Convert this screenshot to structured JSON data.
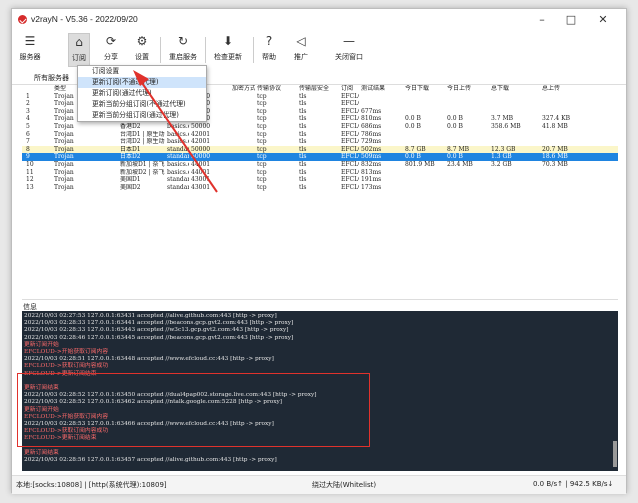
{
  "window": {
    "title": "v2rayN - V5.36 - 2022/09/20",
    "controls": [
      "–",
      "□",
      "✕"
    ]
  },
  "toolbar": [
    {
      "label": "服务器",
      "icon": "server-icon",
      "glyph": "☰"
    },
    {
      "label": "订阅",
      "icon": "subscribe-icon",
      "glyph": "⌂"
    },
    {
      "label": "分享",
      "icon": "share-icon",
      "glyph": "⟳"
    },
    {
      "label": "设置",
      "icon": "settings-icon",
      "glyph": "⚙"
    },
    {
      "label": "重启服务",
      "icon": "restart-icon",
      "glyph": "↻"
    },
    {
      "label": "检查更新",
      "icon": "update-icon",
      "glyph": "⬇"
    },
    {
      "label": "帮助",
      "icon": "help-icon",
      "glyph": "?"
    },
    {
      "label": "推广",
      "icon": "promote-icon",
      "glyph": "◁"
    },
    {
      "label": "关闭窗口",
      "icon": "close-window-icon",
      "glyph": "—"
    }
  ],
  "tabstrip": {
    "label": "所有服务器"
  },
  "menu": {
    "items": [
      {
        "label": "订阅设置",
        "highlight": false
      },
      {
        "label": "更新订阅(不通过代理)",
        "highlight": true
      },
      {
        "label": "更新订阅(通过代理)",
        "highlight": false
      },
      {
        "label": "更新当前分组订阅(不通过代理)",
        "highlight": false
      },
      {
        "label": "更新当前分组订阅(通过代理)",
        "highlight": false
      }
    ]
  },
  "grid": {
    "headers": [
      "类型",
      "别名",
      "地址",
      "端口",
      "加密方式",
      "传输协议",
      "传输层安全",
      "订阅",
      "测试结果",
      "今日下载",
      "今日上传",
      "总下载",
      "总上传"
    ],
    "rows": [
      [
        "Trojan",
        "剩余流量：",
        "basics.efcloud.cc",
        "50000",
        "",
        "tcp",
        "tls",
        "EFCLOUD",
        "",
        "",
        "",
        "",
        ""
      ],
      [
        "Trojan",
        "距离下次重",
        "basics.efcloud.cc",
        "50000",
        "",
        "tcp",
        "tls",
        "EFCLOUD",
        "",
        "",
        "",
        "",
        ""
      ],
      [
        "Trojan",
        "套餐到期：2023-11-01",
        "basics.efcloud.cc",
        "50000",
        "",
        "tcp",
        "tls",
        "EFCLOUD",
        "677ms",
        "",
        "",
        "",
        ""
      ],
      [
        "Trojan",
        "香港D1",
        "basics.efcloud.cc",
        "50000",
        "",
        "tcp",
        "tls",
        "EFCLOUD",
        "810ms",
        "0.0 B",
        "0.0 B",
        "3.7 MB",
        "327.4 KB"
      ],
      [
        "Trojan",
        "香港D2",
        "basics.efcloud.cc",
        "50000",
        "",
        "tcp",
        "tls",
        "EFCLOUD",
        "686ms",
        "0.0 B",
        "0.0 B",
        "358.6 MB",
        "41.8 MB"
      ],
      [
        "Trojan",
        "台湾D1 | 原生动画疯",
        "basics.efcloud.cc",
        "42001",
        "",
        "tcp",
        "tls",
        "EFCLOUD",
        "786ms",
        "",
        "",
        "",
        ""
      ],
      [
        "Trojan",
        "台湾D2 | 原生动画疯",
        "basics.efcloud.cc",
        "42001",
        "",
        "tcp",
        "tls",
        "EFCLOUD",
        "729ms",
        "",
        "",
        "",
        ""
      ],
      [
        "Trojan",
        "日本D1",
        "standard.efcloud.cc",
        "50000",
        "",
        "tcp",
        "tls",
        "EFCLOUD",
        "502ms",
        "8.7 GB",
        "8.7 MB",
        "12.3 GB",
        "20.7 MB"
      ],
      [
        "Trojan",
        "日本D2",
        "standard.efcloud.cc",
        "50000",
        "",
        "tcp",
        "tls",
        "EFCLOUD",
        "509ms",
        "0.0 B",
        "0.0 B",
        "1.3 GB",
        "18.6 MB"
      ],
      [
        "Trojan",
        "新加坡D1 | 奈飞",
        "basics.efcloud.cc",
        "44001",
        "",
        "tcp",
        "tls",
        "EFCLOUD",
        "832ms",
        "801.9 MB",
        "23.4 MB",
        "3.2 GB",
        "70.3 MB"
      ],
      [
        "Trojan",
        "新加坡D2 | 奈飞",
        "basics.efcloud.cc",
        "44001",
        "",
        "tcp",
        "tls",
        "EFCLOUD",
        "813ms",
        "",
        "",
        "",
        ""
      ],
      [
        "Trojan",
        "美国D1",
        "standard.efcloud.cc",
        "43001",
        "",
        "tcp",
        "tls",
        "EFCLOUD",
        "191ms",
        "",
        "",
        "",
        ""
      ],
      [
        "Trojan",
        "美国D2",
        "standard.efcloud.cc",
        "43001",
        "",
        "tcp",
        "tls",
        "EFCLOUD",
        "173ms",
        "",
        "",
        "",
        ""
      ]
    ]
  },
  "log": {
    "label": "信息",
    "lines": [
      "2022/10/03 02:27:53 127.0.0.1:63431 accepted //alive.github.com:443 [http -> proxy]",
      "2022/10/03 02:28:33 127.0.0.1:63441 accepted //beacons.gcp.gvt2.com:443 [http -> proxy]",
      "2022/10/03 02:28:33 127.0.0.1:63443 accepted //w3c13.gcp.gvt2.com:443 [http -> proxy]",
      "2022/10/03 02:28:46 127.0.0.1:63445 accepted //beacons.gcp.gvt2.com:443 [http -> proxy]",
      "更新订阅开始",
      "EFCLOUD->开始获取订阅内容",
      "2022/10/03 02:28:51 127.0.0.1:63448 accepted //www.efcloud.cc:443 [http -> proxy]",
      "EFCLOUD->获取订阅内容成功",
      "EFCLOUD->更新订阅结束",
      "",
      "更新订阅结束",
      "2022/10/03 02:28:52 127.0.0.1:63450 accepted //dual4pap002.storage.live.com:443 [http -> proxy]",
      "2022/10/03 02:28:52 127.0.0.1:63462 accepted //ntalk.google.com:5228 [http -> proxy]",
      "更新订阅开始",
      "EFCLOUD->开始获取订阅内容",
      "2022/10/03 02:28:53 127.0.0.1:63466 accepted //www.efcloud.cc:443 [http -> proxy]",
      "EFCLOUD->获取订阅内容成功",
      "EFCLOUD->更新订阅结束",
      "",
      "更新订阅结束",
      "2022/10/03 02:28:56 127.0.0.1:63457 accepted //alive.github.com:443 [http -> proxy]"
    ]
  },
  "status": {
    "left": "本地:[socks:10808] | [http(系统代理):10809]",
    "middle": "绕过大陆(Whitelist)",
    "right": "0.0 B/s↑ | 942.5 KB/s↓"
  },
  "colors": {
    "selected_row": "#1f84e0",
    "annotation_red": "#e0322c",
    "log_bg": "#1f2935"
  }
}
